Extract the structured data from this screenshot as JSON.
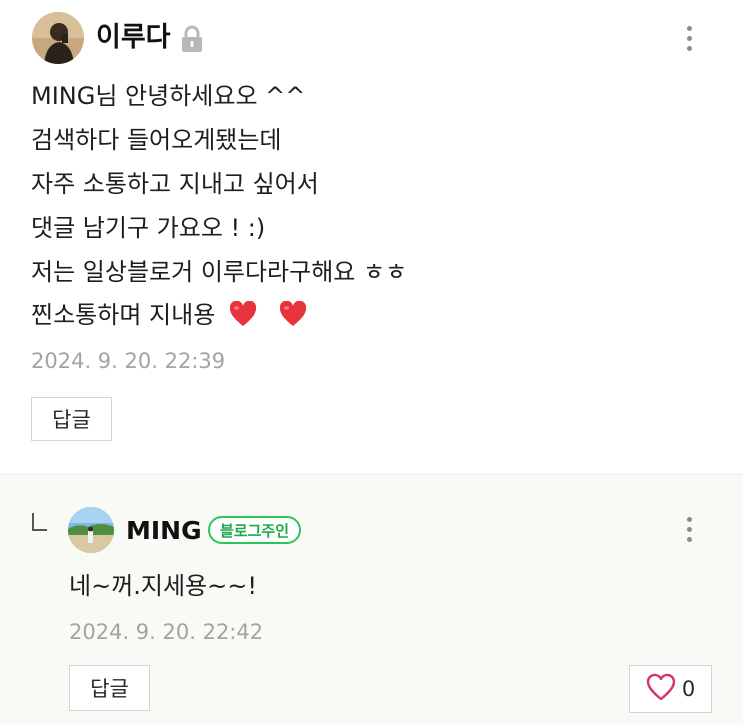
{
  "comment": {
    "author": "이루다",
    "avatar": "user-avatar",
    "private_icon": "lock-icon",
    "menu_icon": "more-vertical-icon",
    "lines": [
      "MING님 안녕하세요오 ^^",
      "검색하다 들어오게됐는데",
      "자주 소통하고 지내고 싶어서",
      "댓글 남기구 가요오 ! :)",
      "저는 일상블로거 이루다라구해요 ㅎㅎ",
      "찐소통하며 지내용"
    ],
    "emoji": [
      "❤️",
      "❤️"
    ],
    "timestamp": "2024. 9. 20. 22:39",
    "reply_label": "답글"
  },
  "reply": {
    "indent_icon": "reply-arrow-icon",
    "author": "MING",
    "avatar": "beach-avatar",
    "badge": "블로그주인",
    "text": "네~꺼.지세용~~!",
    "timestamp": "2024. 9. 20. 22:42",
    "reply_label": "답글",
    "like_icon": "heart-outline-icon",
    "like_count": "0",
    "menu_icon": "more-vertical-icon"
  },
  "colors": {
    "badge_green": "#2fc35a",
    "heart_red": "#e8323c",
    "like_pink": "#d6336c",
    "reply_bg": "#f9faf6",
    "timestamp_gray": "#a3a3a3"
  }
}
